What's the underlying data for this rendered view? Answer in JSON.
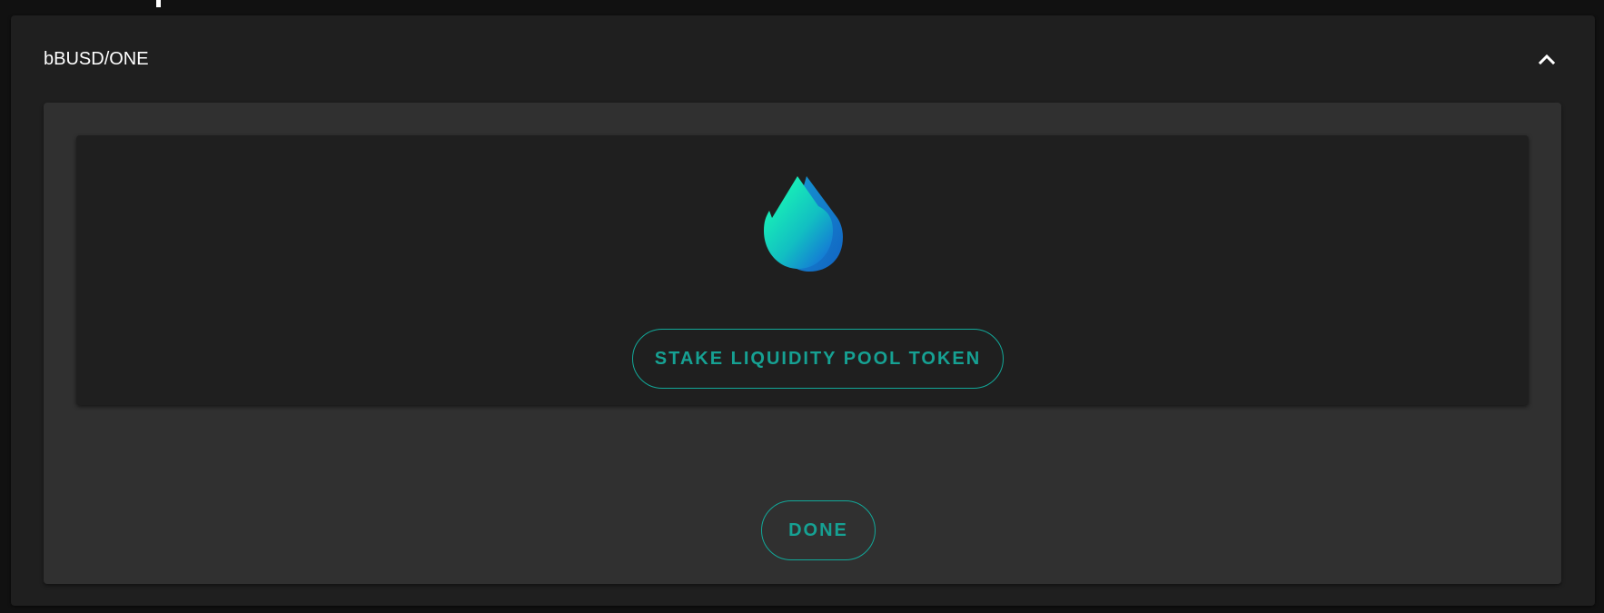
{
  "accordion": {
    "title": "bBUSD/ONE",
    "expanded": true,
    "toggle_icon": "chevron-up-icon"
  },
  "card": {
    "icon": "water-drop-icon",
    "stake_button_label": "STAKE LIQUIDITY POOL TOKEN"
  },
  "done_button_label": "DONE",
  "colors": {
    "background": "#111111",
    "accordion_bg": "#1f1f1f",
    "panel_bg": "#303030",
    "accent": "#16a193",
    "drop_gradient_start": "#18f2b6",
    "drop_gradient_end": "#1476d6"
  }
}
